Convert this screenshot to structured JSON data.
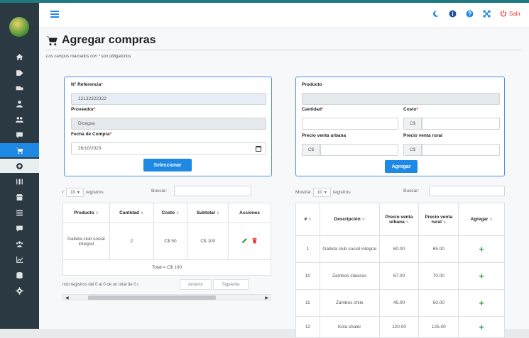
{
  "nav": {
    "salir_label": "Salir"
  },
  "page": {
    "title": "Agregar compras",
    "required_note": "Los campos marcados con * son obligatorios"
  },
  "purchase_form": {
    "referencia_label": "N° Referencia",
    "referencia_value": "12132322322",
    "proveedor_label": "Proveedor",
    "proveedor_value": "Dicegsa",
    "fecha_label": "Fecha de Compra",
    "fecha_value": "26/10/2023",
    "seleccionar_label": "Seleccionar"
  },
  "product_form": {
    "producto_label": "Producto",
    "producto_value": "",
    "cantidad_label": "Cantidad",
    "costo_label": "Costo",
    "currency": "C$",
    "precio_urbana_label": "Precio venta urbana",
    "precio_rural_label": "Precio venta rural",
    "agregar_label": "Agregar"
  },
  "cart_table": {
    "show_prefix": "r",
    "page_size": "10",
    "registros_label": "registros",
    "search_label": "Buscar:",
    "headers": [
      "Producto",
      "Cantidad",
      "Costo",
      "Subtotal",
      "Acciones"
    ],
    "rows": [
      {
        "producto": "Galleta club social integral",
        "cantidad": "2",
        "costo": "C$ 50",
        "subtotal": "C$ 100"
      }
    ],
    "total": "Total = C$ 100",
    "info": "ndo registros del 0 al 0 de un total de 0 r",
    "prev_label": "Anterior",
    "next_label": "Siguiente"
  },
  "product_table": {
    "show_label": "Mostrar",
    "page_size": "10",
    "registros_label": "registros",
    "search_label": "Buscar:",
    "headers": [
      "#",
      "Descripción",
      "Precio venta urbana",
      "Precio venta rural",
      "Agregar"
    ],
    "rows": [
      {
        "id": "1",
        "descripcion": "Galleta club social integral",
        "urbana": "60.00",
        "rural": "65.00"
      },
      {
        "id": "10",
        "descripcion": "Zambos clásicos",
        "urbana": "67.00",
        "rural": "70.00"
      },
      {
        "id": "11",
        "descripcion": "Zambos chile",
        "urbana": "45.00",
        "rural": "50.00"
      },
      {
        "id": "12",
        "descripcion": "Kola shaler",
        "urbana": "120.00",
        "rural": "125.00"
      }
    ]
  },
  "colors": {
    "accent": "#1e88e5",
    "sidebar": "#2b3a42",
    "danger": "#e53935",
    "success": "#2e9e44"
  }
}
